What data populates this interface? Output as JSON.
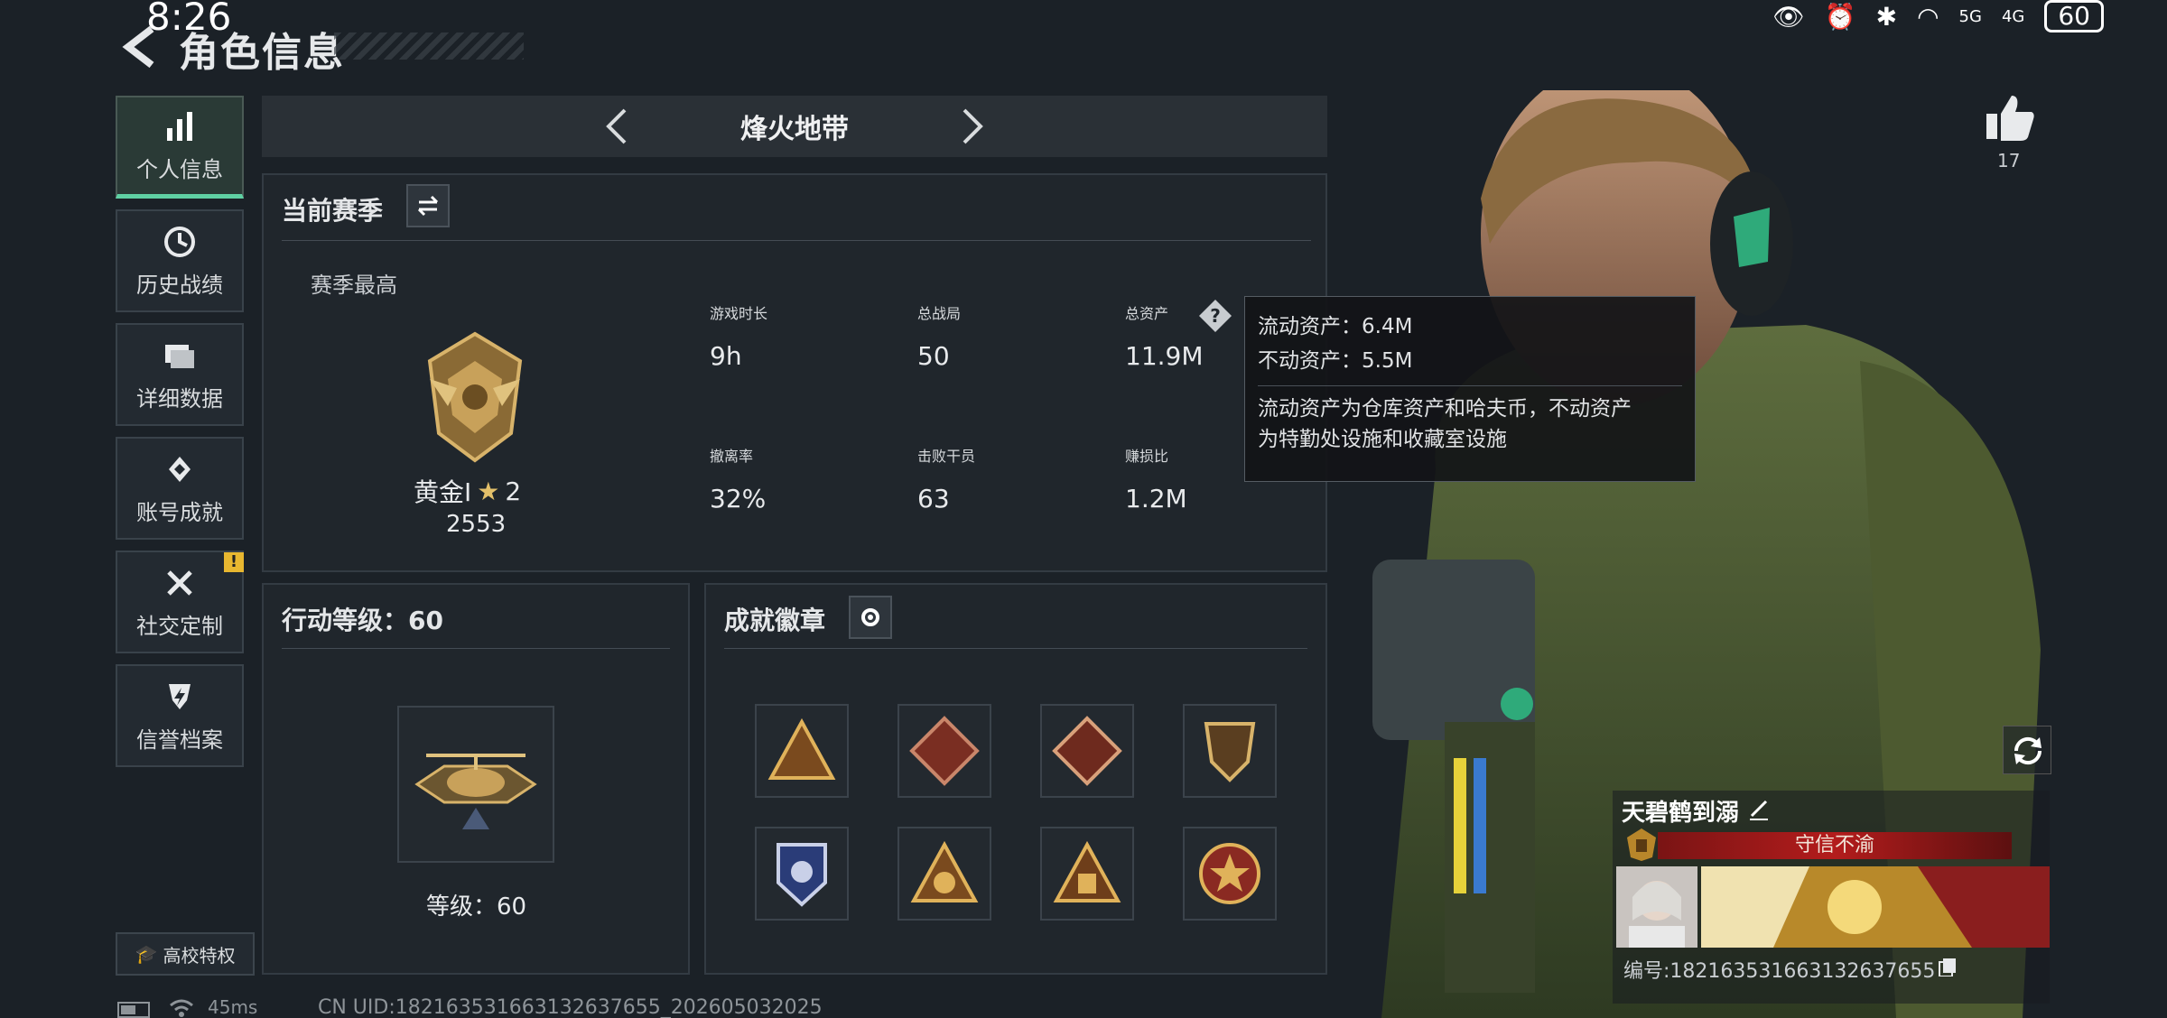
{
  "status_bar": {
    "time": "8:26",
    "battery": "60",
    "network_a": "5G",
    "network_b": "4G"
  },
  "header": {
    "title": "角色信息"
  },
  "nav": {
    "items": [
      {
        "label": "个人信息",
        "icon": "bar-chart-icon",
        "active": true
      },
      {
        "label": "历史战绩",
        "icon": "history-icon",
        "active": false
      },
      {
        "label": "详细数据",
        "icon": "folder-icon",
        "active": false
      },
      {
        "label": "账号成就",
        "icon": "achievement-icon",
        "active": false
      },
      {
        "label": "社交定制",
        "icon": "tools-icon",
        "active": false
      },
      {
        "label": "信誉档案",
        "icon": "shield-icon",
        "active": false
      }
    ],
    "alert_badge": "!",
    "campus_label": "高校特权"
  },
  "mode": {
    "title": "烽火地带"
  },
  "season": {
    "title": "当前赛季",
    "best_label": "赛季最高",
    "rank_name": "黄金Ⅰ",
    "rank_stars": "2",
    "rank_points": "2553",
    "stats": [
      {
        "label": "游戏时长",
        "value": "9h"
      },
      {
        "label": "总战局",
        "value": "50"
      },
      {
        "label": "总资产",
        "value": "11.9M"
      },
      {
        "label": "撤离率",
        "value": "32%"
      },
      {
        "label": "击败干员",
        "value": "63"
      },
      {
        "label": "赚损比",
        "value": "1.2M"
      }
    ]
  },
  "tooltip": {
    "line1": "流动资产：6.4M",
    "line2": "不动资产：5.5M",
    "desc1": "流动资产为仓库资产和哈夫币，不动资产",
    "desc2": "为特勤处设施和收藏室设施"
  },
  "action_level": {
    "title": "行动等级：60",
    "label": "等级：60"
  },
  "badges": {
    "title": "成就徽章"
  },
  "profile": {
    "likes": "17",
    "player_name": "天碧鹤到溺",
    "title_text": "守信不渝",
    "player_id": "编号:1821635316631326376​55"
  },
  "footer": {
    "ping": "45ms",
    "uid": "CN UID:1821635316631326376​55_202605032025"
  },
  "colors": {
    "accent": "#5fd0a3",
    "gold": "#c8a15a",
    "alert": "#e8b730",
    "title_red": "#b31c1c"
  }
}
